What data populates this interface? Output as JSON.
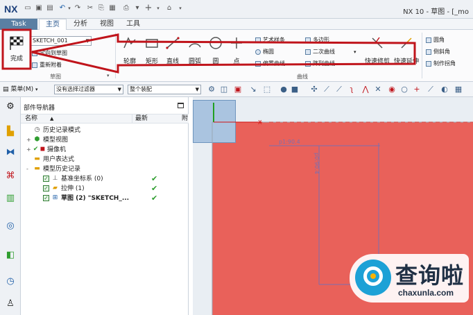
{
  "app": {
    "logo": "NX",
    "title": "NX 10 - 草图 - [_mo"
  },
  "quick_access": {
    "icons": [
      "new-file-icon",
      "save-icon",
      "undo-icon",
      "redo-icon",
      "cut-icon",
      "copy-icon",
      "print-icon",
      "add-icon",
      "window-icon"
    ]
  },
  "menu_tabs": {
    "task": "Task",
    "items": [
      "主页",
      "分析",
      "视图",
      "工具"
    ],
    "active": "主页"
  },
  "ribbon": {
    "finish_label": "完成",
    "sketch_name": "SKETCH_001",
    "commands_small": [
      "定向到草图",
      "重新附着"
    ],
    "sketch_group_label": "草图",
    "curve_group_label": "曲线",
    "big_commands": [
      "轮廓",
      "矩形",
      "直线",
      "圆弧",
      "圆",
      "点"
    ],
    "list_col1": [
      "艺术样条",
      "椭圆",
      "偏置曲线"
    ],
    "list_col2": [
      "多边形",
      "二次曲线",
      "阵列曲线"
    ],
    "trim_commands": [
      "快速修剪",
      "快速延伸"
    ],
    "right_commands": [
      "圆角",
      "倒斜角",
      "制作拐角"
    ]
  },
  "filterbar": {
    "menu_label": "菜单(M)",
    "filter_value": "没有选择过滤器",
    "assembly_value": "整个装配"
  },
  "navigator": {
    "title": "部件导航器",
    "col_name": "名称",
    "col_latest": "最新",
    "col_extra": "附",
    "rows": [
      {
        "label": "历史记录模式",
        "icon": "clock-icon",
        "expand": "",
        "check": false,
        "latest": ""
      },
      {
        "label": "模型视图",
        "icon": "model-view-icon",
        "expand": "+",
        "check": false,
        "latest": ""
      },
      {
        "label": "摄像机",
        "icon": "camera-icon",
        "expand": "+",
        "check": true,
        "latest": ""
      },
      {
        "label": "用户表达式",
        "icon": "folder-icon",
        "expand": "",
        "check": false,
        "latest": ""
      },
      {
        "label": "模型历史记录",
        "icon": "folder-icon",
        "expand": "-",
        "check": false,
        "latest": ""
      },
      {
        "label": "基准坐标系 (0)",
        "icon": "datum-csys-icon",
        "expand": "",
        "check": true,
        "latest": "✔"
      },
      {
        "label": "拉伸 (1)",
        "icon": "extrude-icon",
        "expand": "",
        "check": true,
        "latest": "✔"
      },
      {
        "label": "草图 (2) \"SKETCH_...",
        "icon": "sketch-icon",
        "expand": "",
        "check": true,
        "latest": "✔"
      }
    ]
  },
  "graphics": {
    "dim_horizontal": "p1:90.4",
    "dim_vertical": "p0:90.4",
    "axis_label": "X"
  },
  "watermark": {
    "title": "查询啦",
    "url": "chaxunla.com"
  },
  "colors": {
    "sketch_plane": "#e9615a",
    "annotation": "#c0141b",
    "accent": "#5a7fa3"
  }
}
